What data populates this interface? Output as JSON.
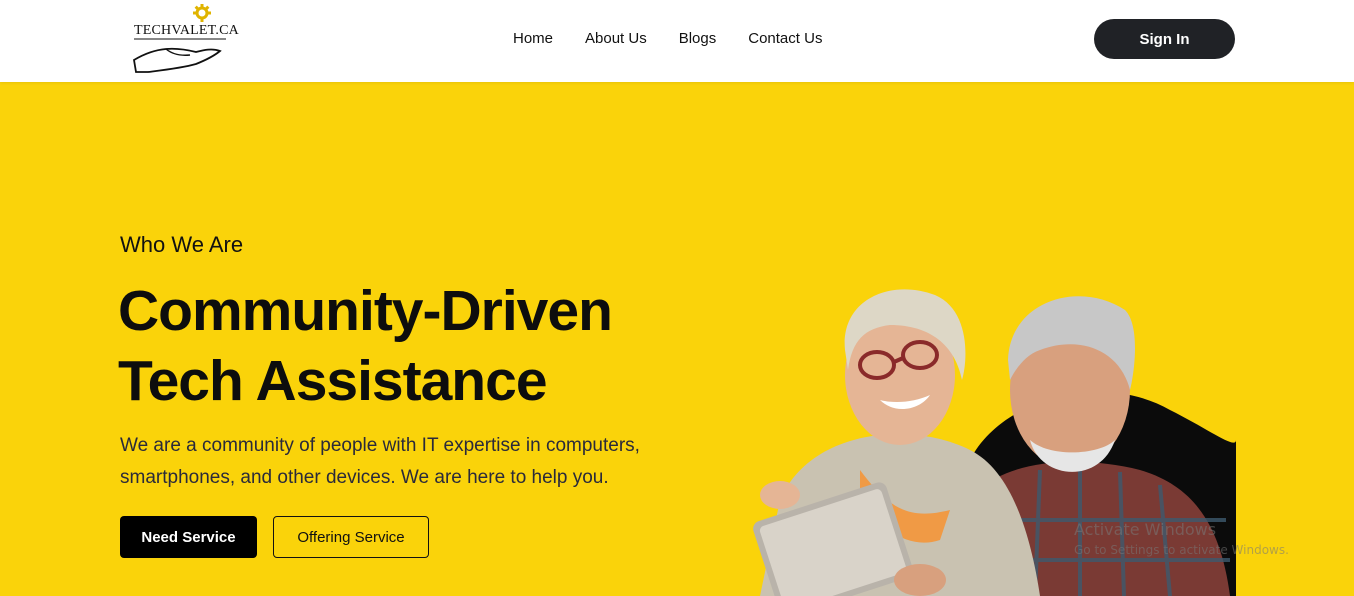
{
  "header": {
    "logo_text": "TECHVALET.CA",
    "nav": [
      "Home",
      "About Us",
      "Blogs",
      "Contact Us"
    ],
    "signin_label": "Sign In"
  },
  "hero": {
    "eyebrow": "Who We Are",
    "headline_line1": "Community-Driven",
    "headline_line2": "Tech Assistance",
    "description": "We are a community of people with IT expertise in computers, smartphones, and other devices. We are here to help you.",
    "primary_button": "Need Service",
    "secondary_button": "Offering Service"
  },
  "watermark": {
    "line1": "Activate Windows",
    "line2": "Go to Settings to activate Windows."
  },
  "colors": {
    "background": "#fad30a",
    "header_bg": "#ffffff",
    "signin_bg": "#202226",
    "primary_button_bg": "#000000"
  },
  "icons": [
    "gear-icon",
    "hand-icon"
  ]
}
